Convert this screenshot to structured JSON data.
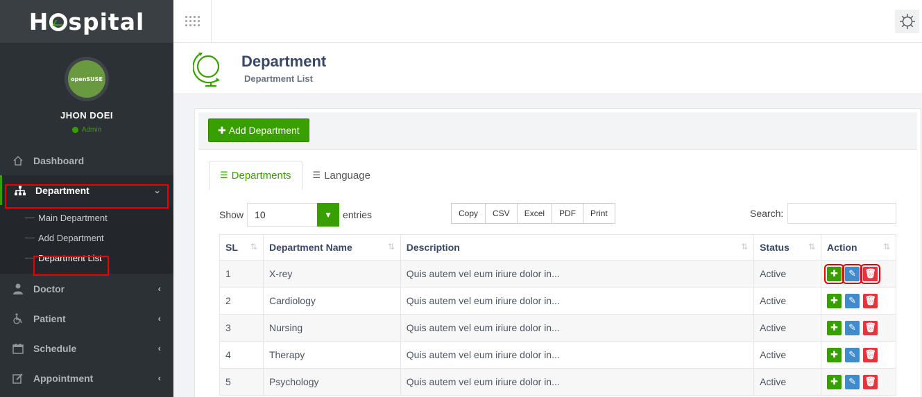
{
  "app": {
    "logo_text_left": "H",
    "logo_text_right": "spital"
  },
  "user": {
    "name": "JHON DOEI",
    "role": "Admin",
    "avatar_text": "openSUSE"
  },
  "menu": {
    "dashboard": "Dashboard",
    "department": "Department",
    "department_sub": [
      "Main Department",
      "Add Department",
      "Department List"
    ],
    "doctor": "Doctor",
    "patient": "Patient",
    "schedule": "Schedule",
    "appointment": "Appointment"
  },
  "header": {
    "title": "Department",
    "subtitle": "Department List"
  },
  "panel": {
    "add_button": "Add Department"
  },
  "tabs": [
    "Departments",
    "Language"
  ],
  "controls": {
    "show_label": "Show",
    "entries_value": "10",
    "entries_label": "entries",
    "export": [
      "Copy",
      "CSV",
      "Excel",
      "PDF",
      "Print"
    ],
    "search_label": "Search:"
  },
  "table": {
    "headers": [
      "SL",
      "Department Name",
      "Description",
      "Status",
      "Action"
    ],
    "rows": [
      {
        "sl": "1",
        "name": "X-rey",
        "desc": "Quis autem vel eum iriure dolor in...",
        "status": "Active"
      },
      {
        "sl": "2",
        "name": "Cardiology",
        "desc": "Quis autem vel eum iriure dolor in...",
        "status": "Active"
      },
      {
        "sl": "3",
        "name": "Nursing",
        "desc": "Quis autem vel eum iriure dolor in...",
        "status": "Active"
      },
      {
        "sl": "4",
        "name": "Therapy",
        "desc": "Quis autem vel eum iriure dolor in...",
        "status": "Active"
      },
      {
        "sl": "5",
        "name": "Psychology",
        "desc": "Quis autem vel eum iriure dolor in...",
        "status": "Active"
      }
    ]
  },
  "colors": {
    "accent": "#37a000",
    "edit": "#428bca",
    "delete": "#e5343d",
    "sidebar": "#2c3136"
  }
}
